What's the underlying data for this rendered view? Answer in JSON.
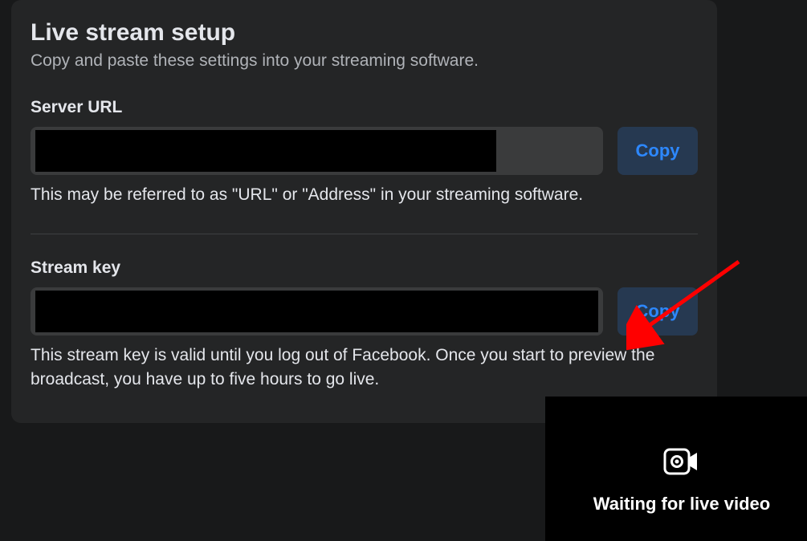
{
  "card": {
    "title": "Live stream setup",
    "subtitle": "Copy and paste these settings into your streaming software.",
    "server": {
      "label": "Server URL",
      "help": "This may be referred to as \"URL\" or \"Address\" in your streaming software.",
      "copy_label": "Copy"
    },
    "stream_key": {
      "label": "Stream key",
      "help": "This stream key is valid until you log out of Facebook. Once you start to preview the broadcast, you have up to five hours to go live.",
      "copy_label": "Copy"
    }
  },
  "preview": {
    "waiting_text": "Waiting for live video"
  }
}
